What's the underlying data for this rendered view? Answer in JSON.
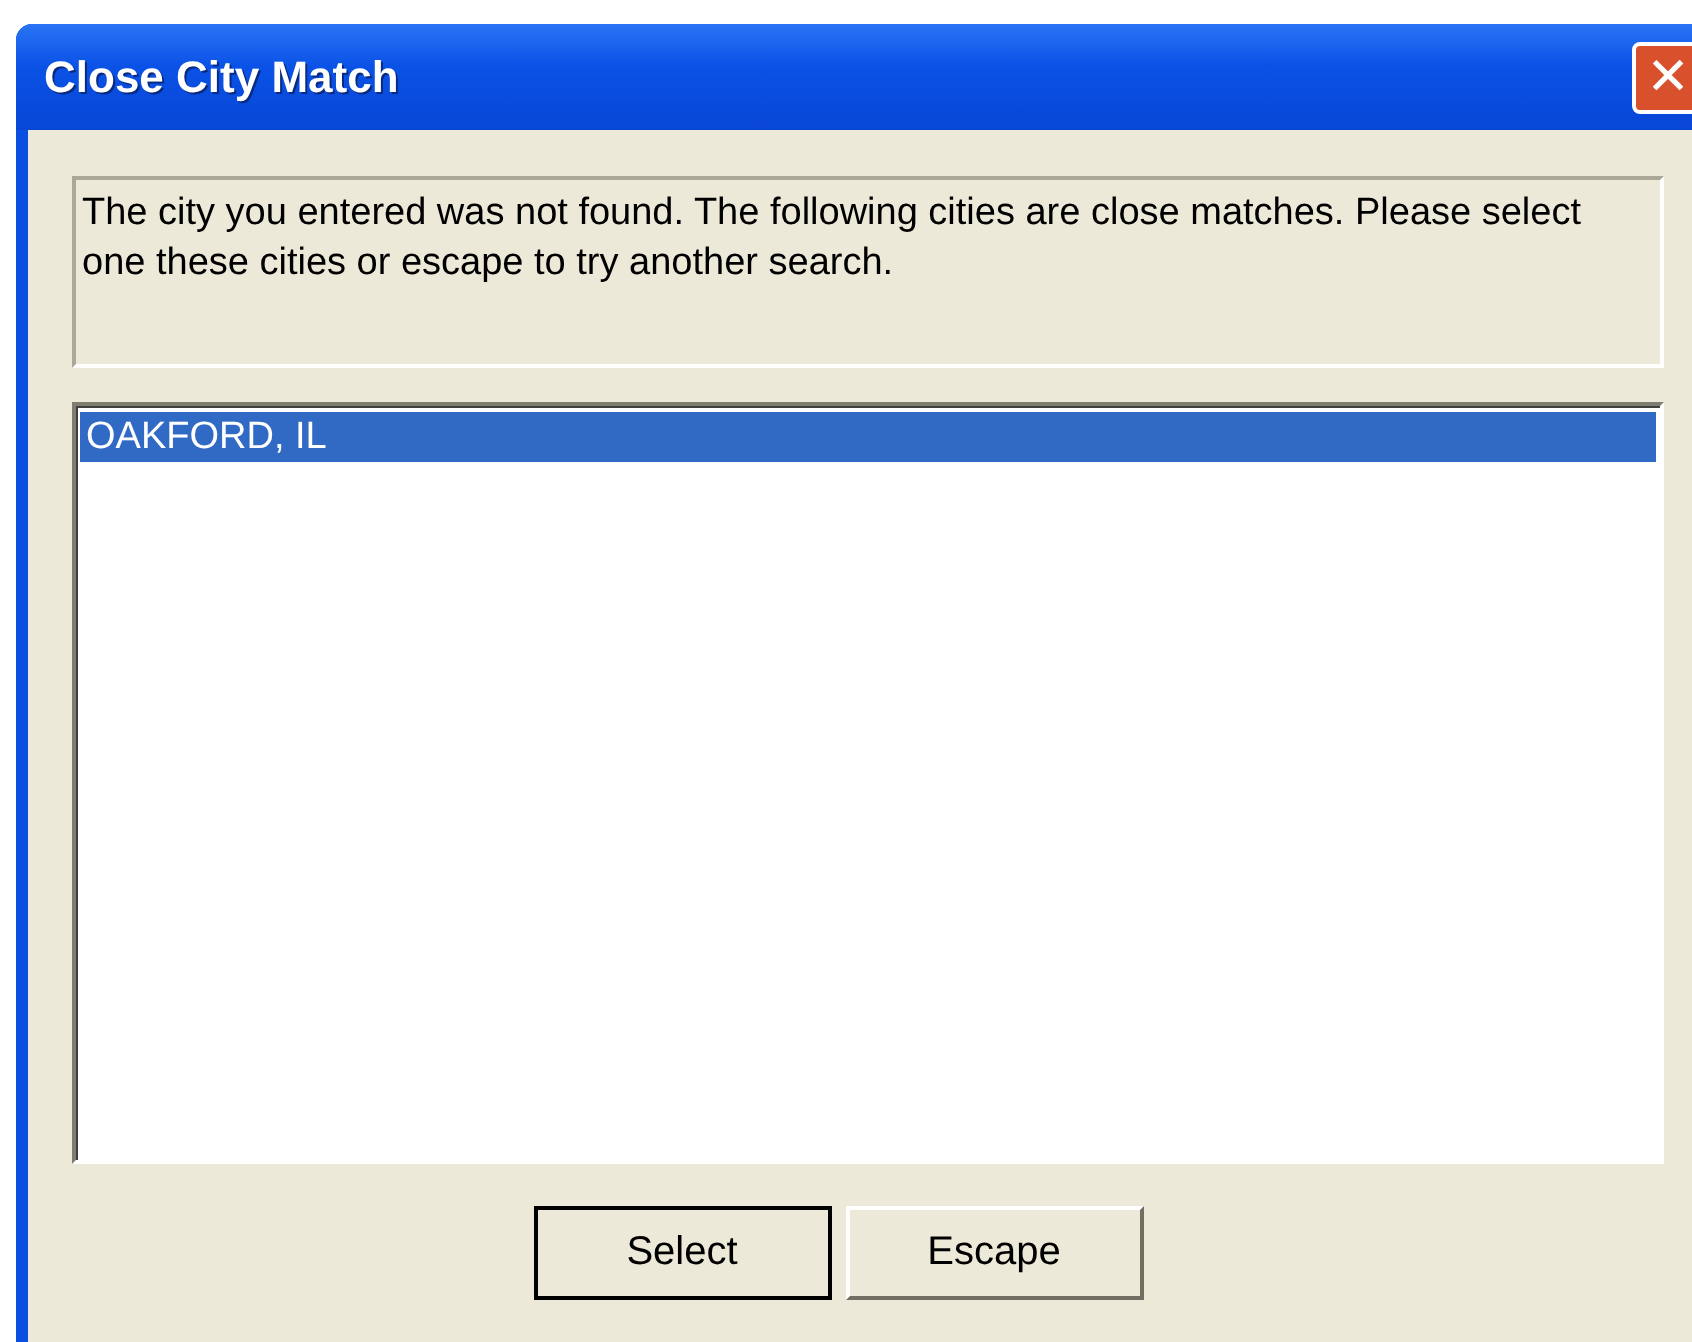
{
  "window": {
    "title": "Close City Match",
    "close_label": "✕"
  },
  "message": "The city you entered was not found.  The following cities are close matches.  Please select one these cities or escape to try another search.",
  "cities": [
    {
      "label": "OAKFORD, IL",
      "selected": true
    }
  ],
  "buttons": [
    {
      "label": "Select",
      "default": true
    },
    {
      "label": "Escape",
      "default": false
    }
  ]
}
